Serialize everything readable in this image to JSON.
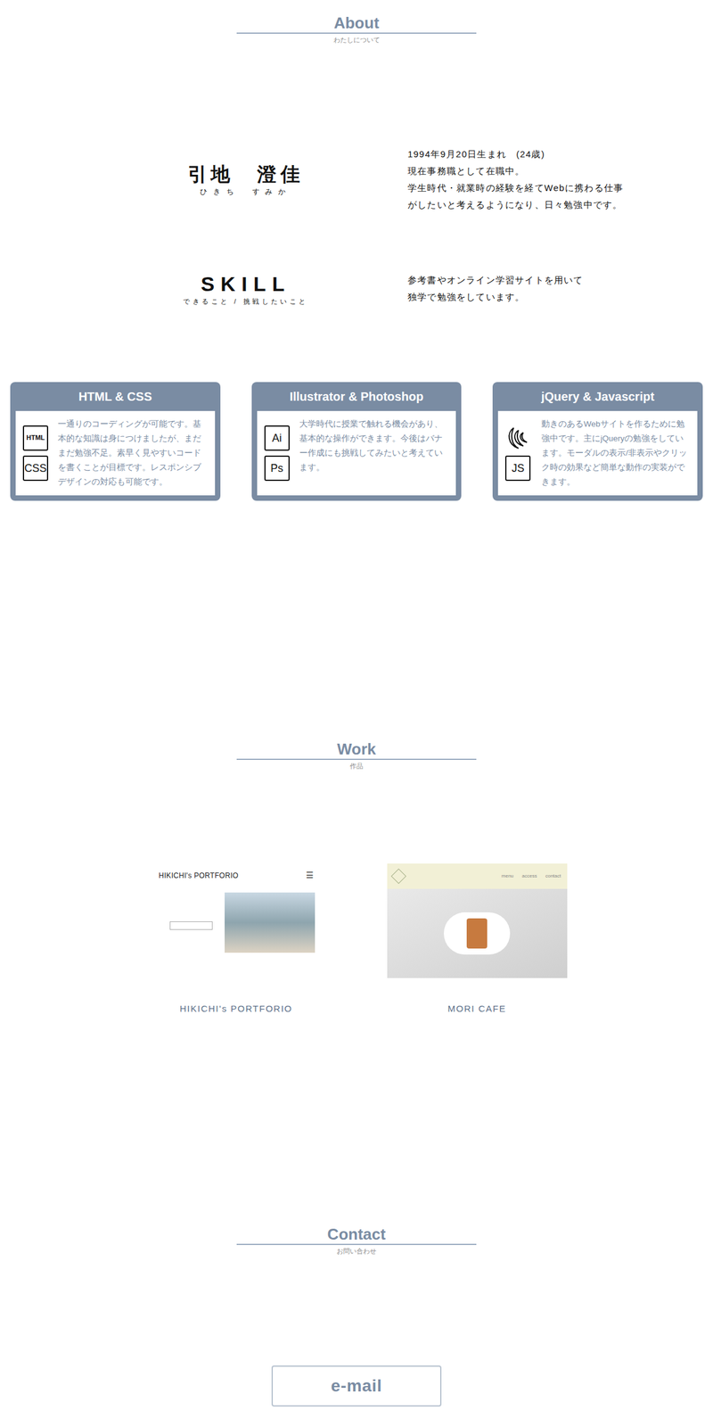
{
  "about": {
    "heading": "About",
    "subtitle": "わたしについて",
    "name": "引地　澄佳",
    "reading": "ひきち　すみか",
    "bio": [
      "1994年9月20日生まれ　(24歳)",
      "現在事務職として在職中。",
      "学生時代・就業時の経験を経てWebに携わる仕事",
      "がしたいと考えるようになり、日々勉強中です。"
    ]
  },
  "skill": {
    "title": "SKILL",
    "subtitle": "できること / 挑戦したいこと",
    "text": [
      "参考書やオンライン学習サイトを用いて",
      "独学で勉強をしています。"
    ]
  },
  "cards": [
    {
      "title": "HTML & CSS",
      "icons": [
        {
          "kind": "box",
          "label": "HTML"
        },
        {
          "kind": "box",
          "label": "CSS"
        }
      ],
      "text": "一通りのコーディングが可能です。基本的な知識は身につけましたが、まだまだ勉強不足。素早く見やすいコードを書くことが目標です。レスポンシブデザインの対応も可能です。"
    },
    {
      "title": "Illustrator & Photoshop",
      "icons": [
        {
          "kind": "box",
          "label": "Ai"
        },
        {
          "kind": "box",
          "label": "Ps"
        }
      ],
      "text": "大学時代に授業で触れる機会があり、基本的な操作ができます。今後はバナー作成にも挑戦してみたいと考えています。"
    },
    {
      "title": "jQuery & Javascript",
      "icons": [
        {
          "kind": "swirl",
          "label": ""
        },
        {
          "kind": "box",
          "label": "JS"
        }
      ],
      "text": "動きのあるWebサイトを作るために勉強中です。主にjQueryの勉強をしています。モーダルの表示/非表示やクリック時の効果など簡単な動作の実装ができます。"
    }
  ],
  "work": {
    "heading": "Work",
    "subtitle": "作品",
    "items": [
      {
        "kind": "portfolio",
        "label": "HIKICHI's PORTFORIO",
        "site_title": "HIKICHI's PORTFORIO",
        "menu_glyph": "☰",
        "links": []
      },
      {
        "kind": "cafe",
        "label": "MORI CAFE",
        "site_title": "",
        "menu_glyph": "",
        "links": [
          "menu",
          "access",
          "contact"
        ]
      }
    ]
  },
  "contact": {
    "heading": "Contact",
    "subtitle": "お問い合わせ",
    "button": "e-mail"
  }
}
